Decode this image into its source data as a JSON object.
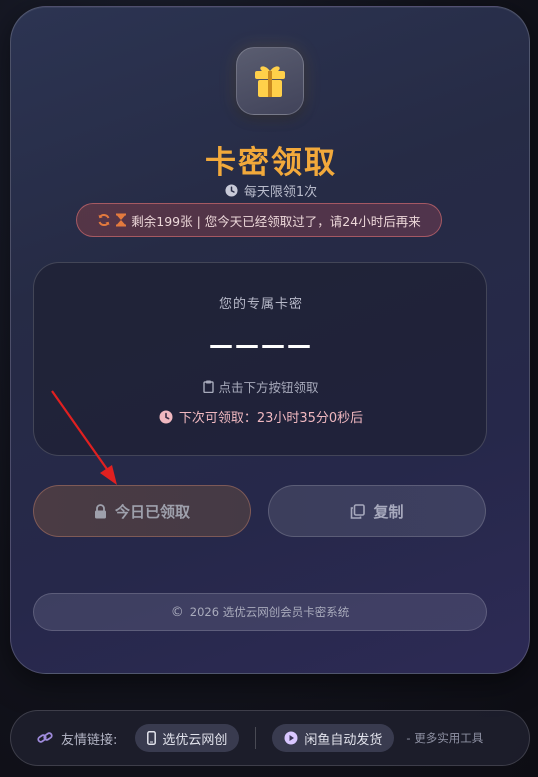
{
  "header": {
    "icon": "gift-icon",
    "title": "卡密领取",
    "subtitle": "每天限领1次",
    "subtitle_icon": "clock-icon"
  },
  "notice": {
    "remaining": "剩余199张",
    "message": " | 您今天已经领取过了，请24小时后再来",
    "icons": [
      "refresh-icon",
      "hourglass-icon"
    ],
    "accent": "#e37a3e"
  },
  "card_box": {
    "label": "您的专属卡密",
    "code": "————",
    "hint": "点击下方按钮领取",
    "countdown": "下次可领取：23小时35分0秒后"
  },
  "buttons": {
    "claim_label": "今日已领取",
    "copy_label": "复制"
  },
  "footer": {
    "copyright_symbol": "©",
    "copyright_text": "2026 选优云网创会员卡密系统"
  },
  "links": {
    "label": "友情链接:",
    "items": [
      {
        "label": "选优云网创",
        "icon": "phone-icon"
      },
      {
        "label": "闲鱼自动发货",
        "icon": "play-icon"
      }
    ],
    "more": "- 更多实用工具"
  },
  "colors": {
    "title": "#f2a93b",
    "gift": "#ffd04a",
    "countdown": "#f0b8c0",
    "annotation_arrow": "#e02020"
  }
}
